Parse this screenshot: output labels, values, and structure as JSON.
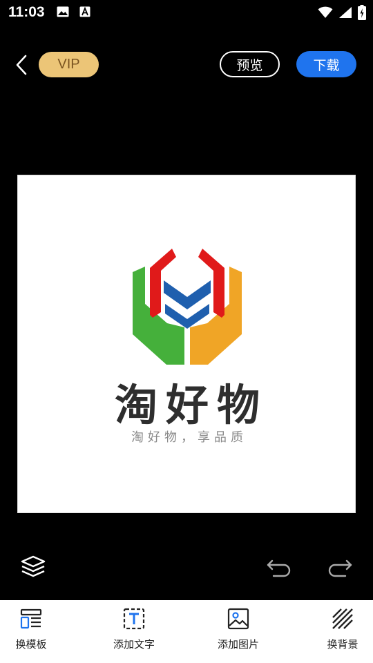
{
  "status_bar": {
    "time": "11:03"
  },
  "toolbar": {
    "vip_label": "VIP",
    "preview_label": "预览",
    "download_label": "下载"
  },
  "canvas": {
    "brand_name": "淘好物",
    "slogan": "淘好物，享品质"
  },
  "bottom_nav": {
    "items": [
      {
        "label": "换模板",
        "icon": "template-icon"
      },
      {
        "label": "添加文字",
        "icon": "text-icon"
      },
      {
        "label": "添加图片",
        "icon": "image-icon"
      },
      {
        "label": "换背景",
        "icon": "background-icon"
      }
    ]
  },
  "colors": {
    "vip_bg": "#ecc577",
    "download_bg": "#1f74ee",
    "accent_blue": "#1f74ee",
    "logo_red": "#e01a1a",
    "logo_blue": "#1f5fae",
    "logo_green": "#45b03b",
    "logo_orange": "#f0a526"
  }
}
